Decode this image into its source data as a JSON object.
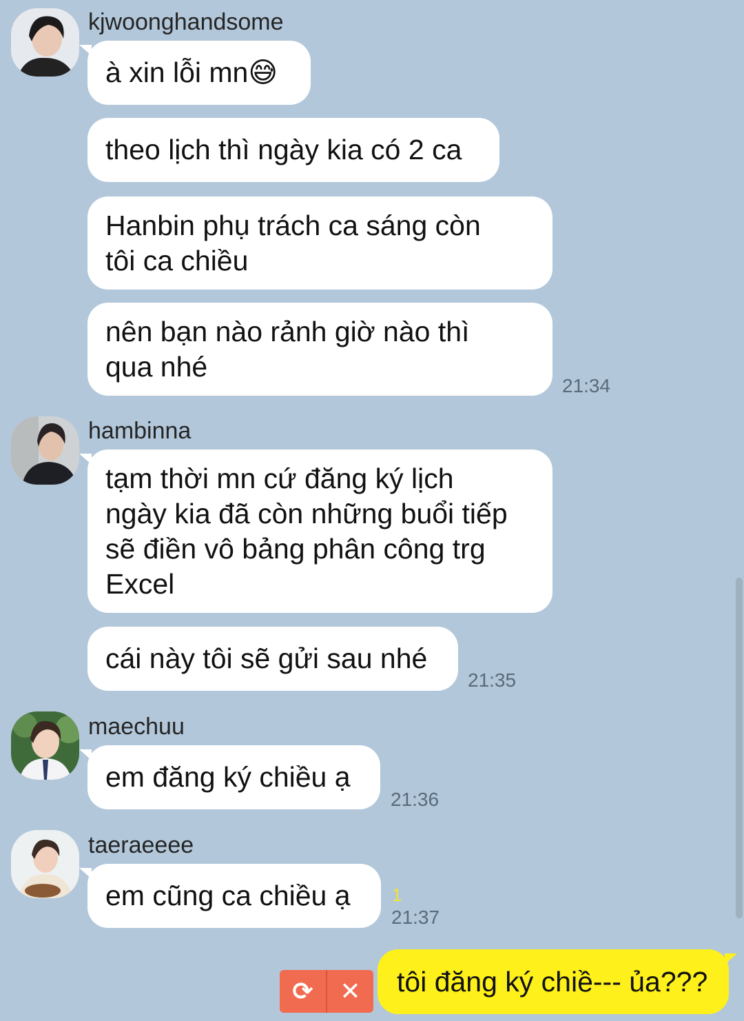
{
  "messages": [
    {
      "sender": "kjwoonghandsome",
      "bubbles": [
        {
          "text": "à xin lỗi mn😅"
        },
        {
          "text": "theo lịch thì ngày kia có 2 ca"
        },
        {
          "text": "Hanbin phụ trách ca sáng còn\ntôi ca chiều"
        },
        {
          "text": "nên bạn nào rảnh giờ nào thì\nqua nhé"
        }
      ],
      "time": "21:34"
    },
    {
      "sender": "hambinna",
      "bubbles": [
        {
          "text": "tạm thời mn cứ đăng ký lịch\nngày kia đã còn những buổi tiếp\nsẽ điền vô bảng phân công trg\nExcel"
        },
        {
          "text": "cái này tôi sẽ gửi sau nhé"
        }
      ],
      "time": "21:35"
    },
    {
      "sender": "maechuu",
      "bubbles": [
        {
          "text": "em đăng ký chiều ạ"
        }
      ],
      "time": "21:36"
    },
    {
      "sender": "taeraeeee",
      "bubbles": [
        {
          "text": "em cũng ca chiều ạ"
        }
      ],
      "unread": "1",
      "time": "21:37"
    }
  ],
  "my_message": {
    "text": "tôi đăng ký chiề--- ủa???",
    "retry_icon": "retry-icon",
    "delete_icon": "close-icon",
    "retry_glyph": "⟳",
    "delete_glyph": "✕"
  },
  "colors": {
    "background": "#b2c7da",
    "other_bubble": "#ffffff",
    "my_bubble": "#fef01b",
    "failed_send": "#f06b4f"
  }
}
